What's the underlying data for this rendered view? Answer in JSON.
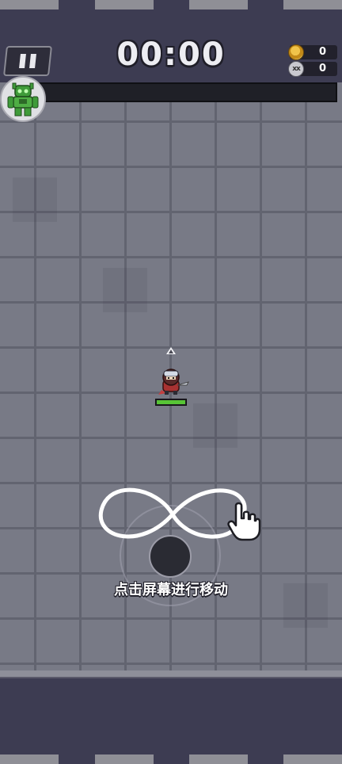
{
  "hud": {
    "timer": "00:00",
    "coins": "0",
    "kills": "0",
    "xp_progress": 0
  },
  "player": {
    "hp_fraction": 1.0
  },
  "hint": {
    "text": "点击屏幕进行移动"
  },
  "icons": {
    "pause": "pause-icon",
    "coin": "coin-icon",
    "kills": "skull-icon",
    "avatar": "green-robot-icon",
    "hand": "pointing-hand-icon",
    "gesture": "infinity-gesture-icon"
  },
  "colors": {
    "background": "#3d3c52",
    "floor": "#787a86",
    "xp": "#3fbf4a",
    "hp": "#57c436"
  }
}
